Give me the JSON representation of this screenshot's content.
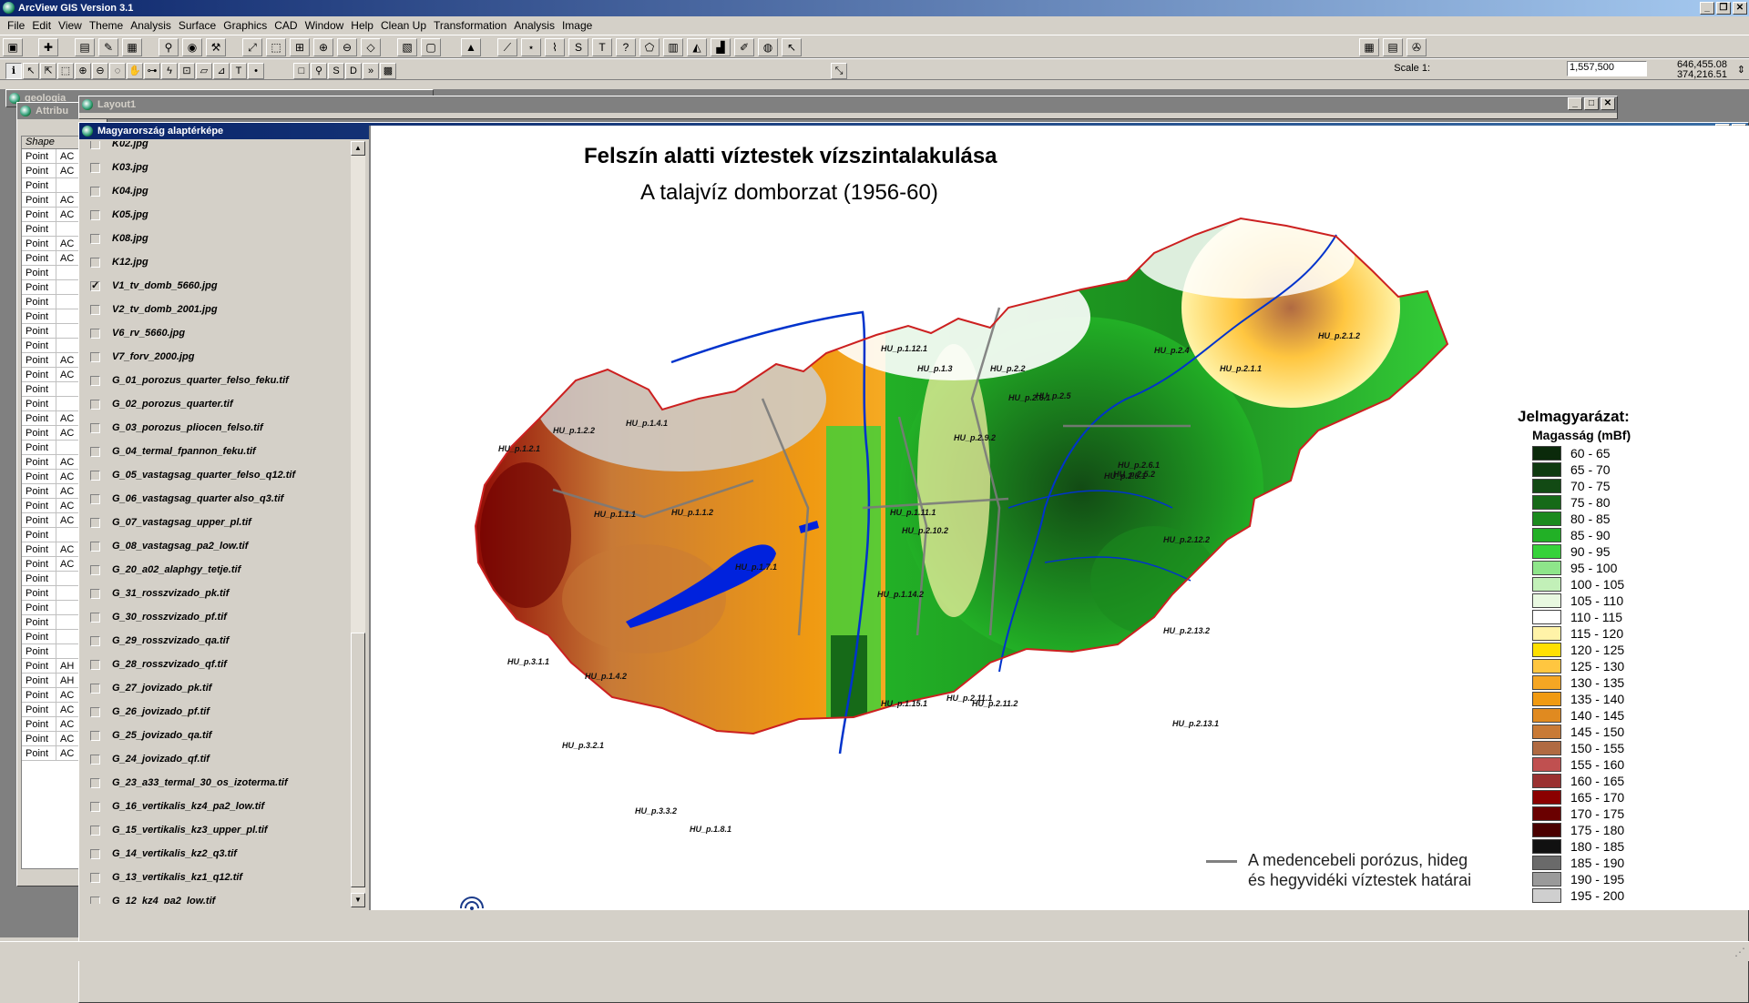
{
  "app": {
    "title": "ArcView GIS Version 3.1"
  },
  "menu": [
    "File",
    "Edit",
    "View",
    "Theme",
    "Analysis",
    "Surface",
    "Graphics",
    "CAD",
    "Window",
    "Help",
    "Clean Up",
    "Transformation",
    "Analysis",
    "Image"
  ],
  "status": {
    "scale_label": "Scale 1:",
    "scale_value": "1,557,500",
    "coord_x": "646,455.08",
    "coord_y": "374,216.51"
  },
  "windows": {
    "geologia_title": "geologia",
    "attributes_title": "Attribu",
    "layout_title": "Layout1",
    "view_title": "Magyarország alaptérképe"
  },
  "attributes": {
    "col1": "Shape",
    "col2": "",
    "rows": [
      [
        "Point",
        "AC"
      ],
      [
        "Point",
        "AC"
      ],
      [
        "Point",
        ""
      ],
      [
        "Point",
        "AC"
      ],
      [
        "Point",
        "AC"
      ],
      [
        "Point",
        ""
      ],
      [
        "Point",
        "AC"
      ],
      [
        "Point",
        "AC"
      ],
      [
        "Point",
        ""
      ],
      [
        "Point",
        ""
      ],
      [
        "Point",
        ""
      ],
      [
        "Point",
        ""
      ],
      [
        "Point",
        ""
      ],
      [
        "Point",
        ""
      ],
      [
        "Point",
        "AC"
      ],
      [
        "Point",
        "AC"
      ],
      [
        "Point",
        ""
      ],
      [
        "Point",
        ""
      ],
      [
        "Point",
        "AC"
      ],
      [
        "Point",
        "AC"
      ],
      [
        "Point",
        ""
      ],
      [
        "Point",
        "AC"
      ],
      [
        "Point",
        "AC"
      ],
      [
        "Point",
        "AC"
      ],
      [
        "Point",
        "AC"
      ],
      [
        "Point",
        "AC"
      ],
      [
        "Point",
        ""
      ],
      [
        "Point",
        "AC"
      ],
      [
        "Point",
        "AC"
      ],
      [
        "Point",
        ""
      ],
      [
        "Point",
        ""
      ],
      [
        "Point",
        ""
      ],
      [
        "Point",
        ""
      ],
      [
        "Point",
        ""
      ],
      [
        "Point",
        ""
      ],
      [
        "Point",
        "AH"
      ],
      [
        "Point",
        "AH"
      ],
      [
        "Point",
        "AC"
      ],
      [
        "Point",
        "AC"
      ],
      [
        "Point",
        "AC"
      ],
      [
        "Point",
        "AC"
      ],
      [
        "Point",
        "AC"
      ]
    ]
  },
  "toc": [
    {
      "label": "K02.jpg",
      "checked": false
    },
    {
      "label": "K03.jpg",
      "checked": false
    },
    {
      "label": "K04.jpg",
      "checked": false
    },
    {
      "label": "K05.jpg",
      "checked": false
    },
    {
      "label": "K08.jpg",
      "checked": false
    },
    {
      "label": "K12.jpg",
      "checked": false
    },
    {
      "label": "V1_tv_domb_5660.jpg",
      "checked": true
    },
    {
      "label": "V2_tv_domb_2001.jpg",
      "checked": false
    },
    {
      "label": "V6_rv_5660.jpg",
      "checked": false
    },
    {
      "label": "V7_forv_2000.jpg",
      "checked": false
    },
    {
      "label": "G_01_porozus_quarter_felso_feku.tif",
      "checked": false
    },
    {
      "label": "G_02_porozus_quarter.tif",
      "checked": false
    },
    {
      "label": "G_03_porozus_pliocen_felso.tif",
      "checked": false
    },
    {
      "label": "G_04_termal_fpannon_feku.tif",
      "checked": false
    },
    {
      "label": "G_05_vastagsag_quarter_felso_q12.tif",
      "checked": false
    },
    {
      "label": "G_06_vastagsag_quarter also_q3.tif",
      "checked": false
    },
    {
      "label": "G_07_vastagsag_upper_pl.tif",
      "checked": false
    },
    {
      "label": "G_08_vastagsag_pa2_low.tif",
      "checked": false
    },
    {
      "label": "G_20_a02_alaphgy_tetje.tif",
      "checked": false
    },
    {
      "label": "G_31_rosszvizado_pk.tif",
      "checked": false
    },
    {
      "label": "G_30_rosszvizado_pf.tif",
      "checked": false
    },
    {
      "label": "G_29_rosszvizado_qa.tif",
      "checked": false
    },
    {
      "label": "G_28_rosszvizado_qf.tif",
      "checked": false
    },
    {
      "label": "G_27_jovizado_pk.tif",
      "checked": false
    },
    {
      "label": "G_26_jovizado_pf.tif",
      "checked": false
    },
    {
      "label": "G_25_jovizado_qa.tif",
      "checked": false
    },
    {
      "label": "G_24_jovizado_qf.tif",
      "checked": false
    },
    {
      "label": "G_23_a33_termal_30_os_izoterma.tif",
      "checked": false
    },
    {
      "label": "G_16_vertikalis_kz4_pa2_low.tif",
      "checked": false
    },
    {
      "label": "G_15_vertikalis_kz3_upper_pl.tif",
      "checked": false
    },
    {
      "label": "G_14_vertikalis_kz2_q3.tif",
      "checked": false
    },
    {
      "label": "G_13_vertikalis_kz1_q12.tif",
      "checked": false
    },
    {
      "label": "G_12_kz4_pa2_low.tif",
      "checked": false
    }
  ],
  "map": {
    "title": "Felszín alatti víztestek vízszintalakulása",
    "subtitle": "A talajvíz domborzat (1956-60)",
    "legend_title": "Jelmagyarázat:",
    "legend_subtitle": "Magasság (mBf)",
    "legend": [
      {
        "label": "60 - 65",
        "color": "#0b2a0b"
      },
      {
        "label": "65 - 70",
        "color": "#0f3a10"
      },
      {
        "label": "70 - 75",
        "color": "#124a14"
      },
      {
        "label": "75 - 80",
        "color": "#166a18"
      },
      {
        "label": "80 - 85",
        "color": "#1b8a1e"
      },
      {
        "label": "85 - 90",
        "color": "#22b026"
      },
      {
        "label": "90 - 95",
        "color": "#36d23a"
      },
      {
        "label": "95 - 100",
        "color": "#8ee58a"
      },
      {
        "label": "100 - 105",
        "color": "#c2f0b8"
      },
      {
        "label": "105 - 110",
        "color": "#e8f8e0"
      },
      {
        "label": "110 - 115",
        "color": "#ffffff"
      },
      {
        "label": "115 - 120",
        "color": "#fff3a8"
      },
      {
        "label": "120 - 125",
        "color": "#ffe000"
      },
      {
        "label": "125 - 130",
        "color": "#ffc640"
      },
      {
        "label": "130 - 135",
        "color": "#f5a623"
      },
      {
        "label": "135 - 140",
        "color": "#f09a12"
      },
      {
        "label": "140 - 145",
        "color": "#e08a20"
      },
      {
        "label": "145 - 150",
        "color": "#c87a36"
      },
      {
        "label": "150 - 155",
        "color": "#b06a42"
      },
      {
        "label": "155 - 160",
        "color": "#c05050"
      },
      {
        "label": "160 - 165",
        "color": "#9a3030"
      },
      {
        "label": "165 - 170",
        "color": "#8b0000"
      },
      {
        "label": "170 - 175",
        "color": "#6a0000"
      },
      {
        "label": "175 - 180",
        "color": "#4a0000"
      },
      {
        "label": "180 - 185",
        "color": "#111111"
      },
      {
        "label": "185 - 190",
        "color": "#6a6a6a"
      },
      {
        "label": "190 - 195",
        "color": "#9a9a9a"
      },
      {
        "label": "195 - 200",
        "color": "#cfcfcf"
      }
    ],
    "boundary_line1": "A medencebeli porózus, hideg",
    "boundary_line2": "és hegyvidéki víztestek határai",
    "regions": [
      "HU_p.1.12.1",
      "HU_p.1.3",
      "HU_p.2.2",
      "HU_p.2.6.1",
      "HU_p.2.5",
      "HU_p.2.4",
      "HU_p.2.1.1",
      "HU_p.2.1.2",
      "HU_p.2.9.2",
      "HU_p.2.6.1",
      "HU_p.2.5.2",
      "HU_p.1.4.1",
      "HU_p.1.2.2",
      "HU_p.1.2.1",
      "HU_p.1.1.1",
      "HU_p.1.1.2",
      "HU_p.1.7.1",
      "HU_p.2.10.2",
      "HU_p.2.12.2",
      "HU_p.2.13.2",
      "HU_p.2.11.1",
      "HU_p.2.11.2",
      "HU_p.2.13.1",
      "HU_p.3.2.1",
      "HU_p.3.1.1",
      "HU_p.1.4.2",
      "HU_p.3.3.2",
      "HU_p.1.8.1",
      "HU_p.2.5.1",
      "HU_p.1.14.2",
      "HU_p.1.15.1",
      "HU_p.1.11.1"
    ]
  }
}
